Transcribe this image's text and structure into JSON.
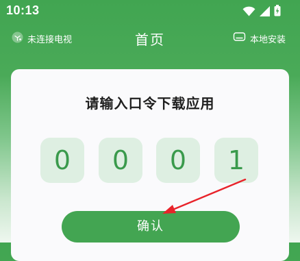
{
  "status_bar": {
    "time": "10:13"
  },
  "header": {
    "left_label": "未连接电视",
    "title": "首页",
    "right_label": "本地安装"
  },
  "card": {
    "title": "请输入口令下载应用",
    "digits": [
      "0",
      "0",
      "0",
      "1"
    ],
    "confirm_label": "确认"
  },
  "colors": {
    "brand_green": "#43a552",
    "digit_bg": "#deefe2",
    "digit_text": "#3a9a4c",
    "annotation_arrow": "#e8232a"
  },
  "icons": {
    "header_left": "tv-disconnected-icon",
    "header_right": "local-install-icon",
    "status": [
      "wifi-icon",
      "signal-icon",
      "battery-icon"
    ]
  }
}
